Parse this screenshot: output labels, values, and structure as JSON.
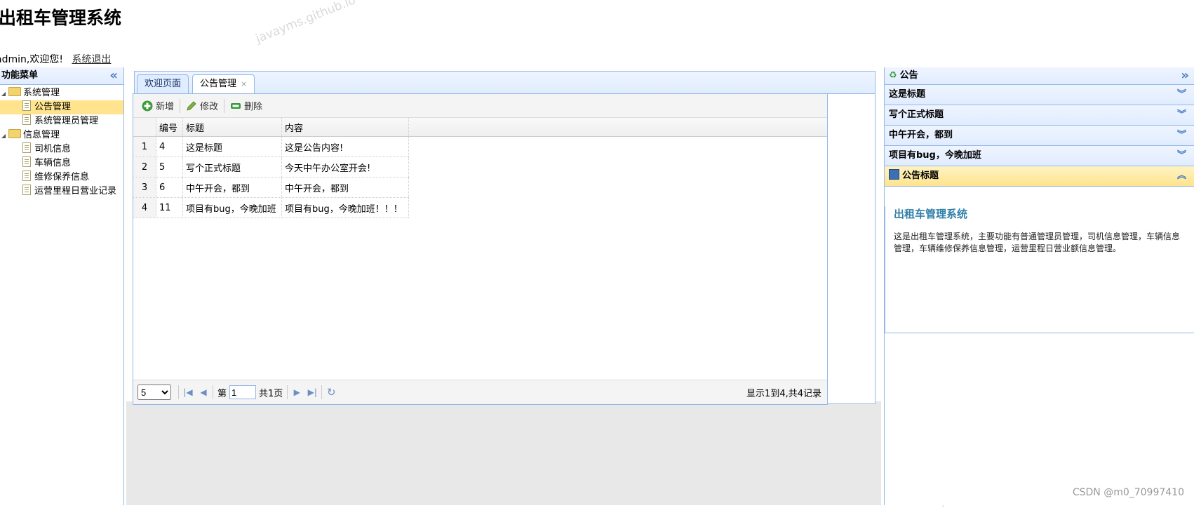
{
  "header": {
    "title": "出租车管理系统",
    "welcome": "admin,欢迎您!",
    "logout": "系统退出"
  },
  "watermarks": [
    "javayms.github.io",
    "javayms.github.io",
    "javayms."
  ],
  "csdn": "CSDN @m0_70997410",
  "left_menu": {
    "title": "功能菜单",
    "groups": [
      {
        "label": "系统管理",
        "items": [
          "公告管理",
          "系统管理员管理"
        ]
      },
      {
        "label": "信息管理",
        "items": [
          "司机信息",
          "车辆信息",
          "维修保养信息",
          "运营里程日营业记录"
        ]
      }
    ],
    "selected": "公告管理"
  },
  "tabs": [
    {
      "label": "欢迎页面"
    },
    {
      "label": "公告管理",
      "close": "×"
    }
  ],
  "toolbar": {
    "add": "新增",
    "edit": "修改",
    "delete": "删除"
  },
  "grid": {
    "columns": [
      "编号",
      "标题",
      "内容"
    ],
    "rows": [
      {
        "rn": "1",
        "id": "4",
        "title": "这是标题",
        "content": "这是公告内容!"
      },
      {
        "rn": "2",
        "id": "5",
        "title": "写个正式标题",
        "content": "今天中午办公室开会!"
      },
      {
        "rn": "3",
        "id": "6",
        "title": "中午开会，都到",
        "content": "中午开会，都到"
      },
      {
        "rn": "4",
        "id": "11",
        "title": "项目有bug，今晚加班",
        "content": "项目有bug，今晚加班！！！"
      }
    ]
  },
  "pager": {
    "page_size": "5",
    "page_prefix": "第",
    "page_value": "1",
    "page_suffix": "共1页",
    "info": "显示1到4,共4记录"
  },
  "right_panel": {
    "title": "公告",
    "items": [
      "这是标题",
      "写个正式标题",
      "中午开会，都到",
      "项目有bug，今晚加班"
    ],
    "open_item": "公告标题",
    "content_title": "出租车管理系统",
    "content_text": "这是出租车管理系统，主要功能有普通管理员管理，司机信息管理，车辆信息管理，车辆维修保养信息管理，运营里程日营业额信息管理。"
  },
  "colors": {
    "border": "#95b8e7",
    "selected": "#ffe48d",
    "accent": "#2f7fa8"
  }
}
